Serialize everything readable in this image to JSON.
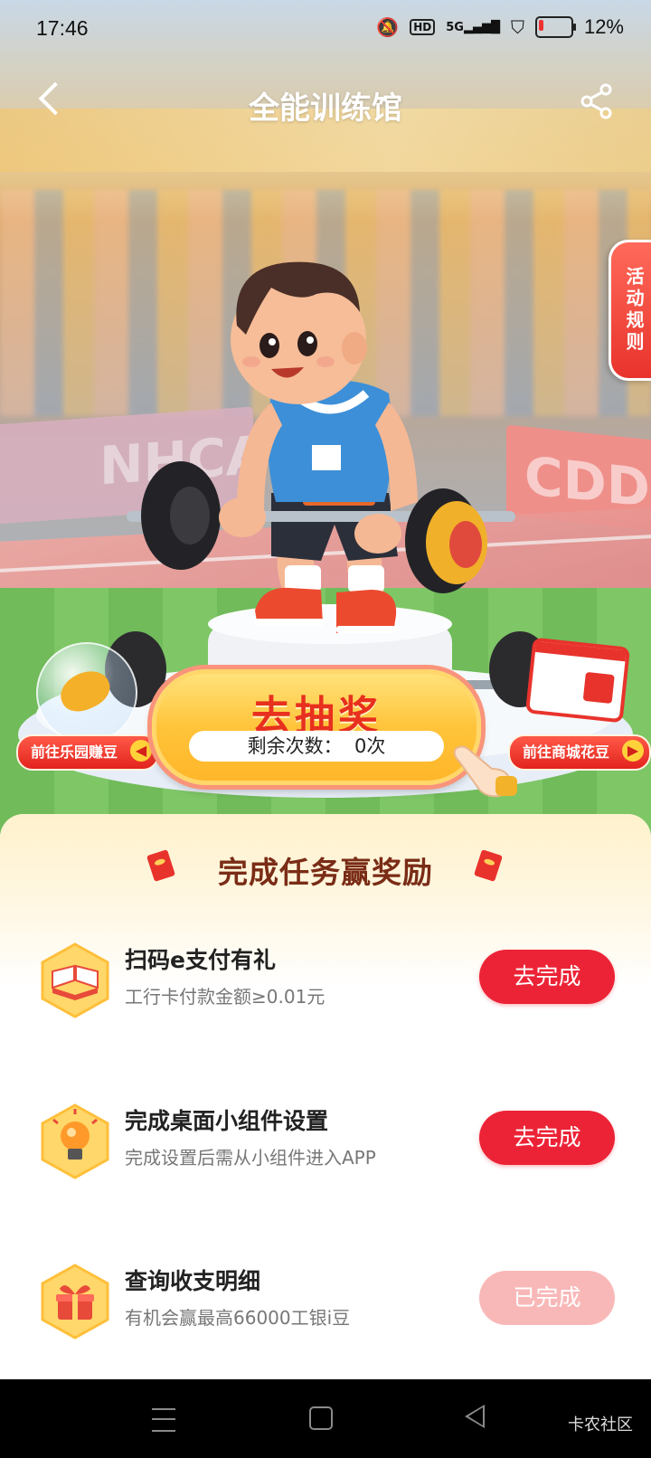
{
  "status_bar": {
    "time": "17:46",
    "network": "5G",
    "hd_label": "HD",
    "battery": "12%"
  },
  "nav": {
    "title": "全能训练馆"
  },
  "side_tab": {
    "rules": "活动规则"
  },
  "stadium_banners": {
    "left": "NHCAC",
    "right": "CDDC"
  },
  "promo": {
    "left_link": "前往乐园赚豆",
    "right_link": "前往商城花豆",
    "draw_button": "去抽奖",
    "remaining_label": "剩余次数：",
    "remaining_count": "0次"
  },
  "tasks_panel": {
    "title": "完成任务赢奖励",
    "tasks": [
      {
        "icon": "book-icon",
        "title": "扫码e支付有礼",
        "subtitle": "工行卡付款金额≥0.01元",
        "action": "去完成",
        "state": "pending"
      },
      {
        "icon": "lightbulb-icon",
        "title": "完成桌面小组件设置",
        "subtitle": "完成设置后需从小组件进入APP",
        "action": "去完成",
        "state": "pending"
      },
      {
        "icon": "gift-icon",
        "title": "查询收支明细",
        "subtitle": "有机会赢最高66000工银i豆",
        "action": "已完成",
        "state": "done"
      }
    ]
  },
  "system_nav": {
    "watermark": "卡农社区"
  },
  "colors": {
    "accent_red": "#ec2336",
    "done_pink": "#f9b8b8",
    "draw_gold": "#ffc43a",
    "title_brown": "#7a2c16"
  }
}
